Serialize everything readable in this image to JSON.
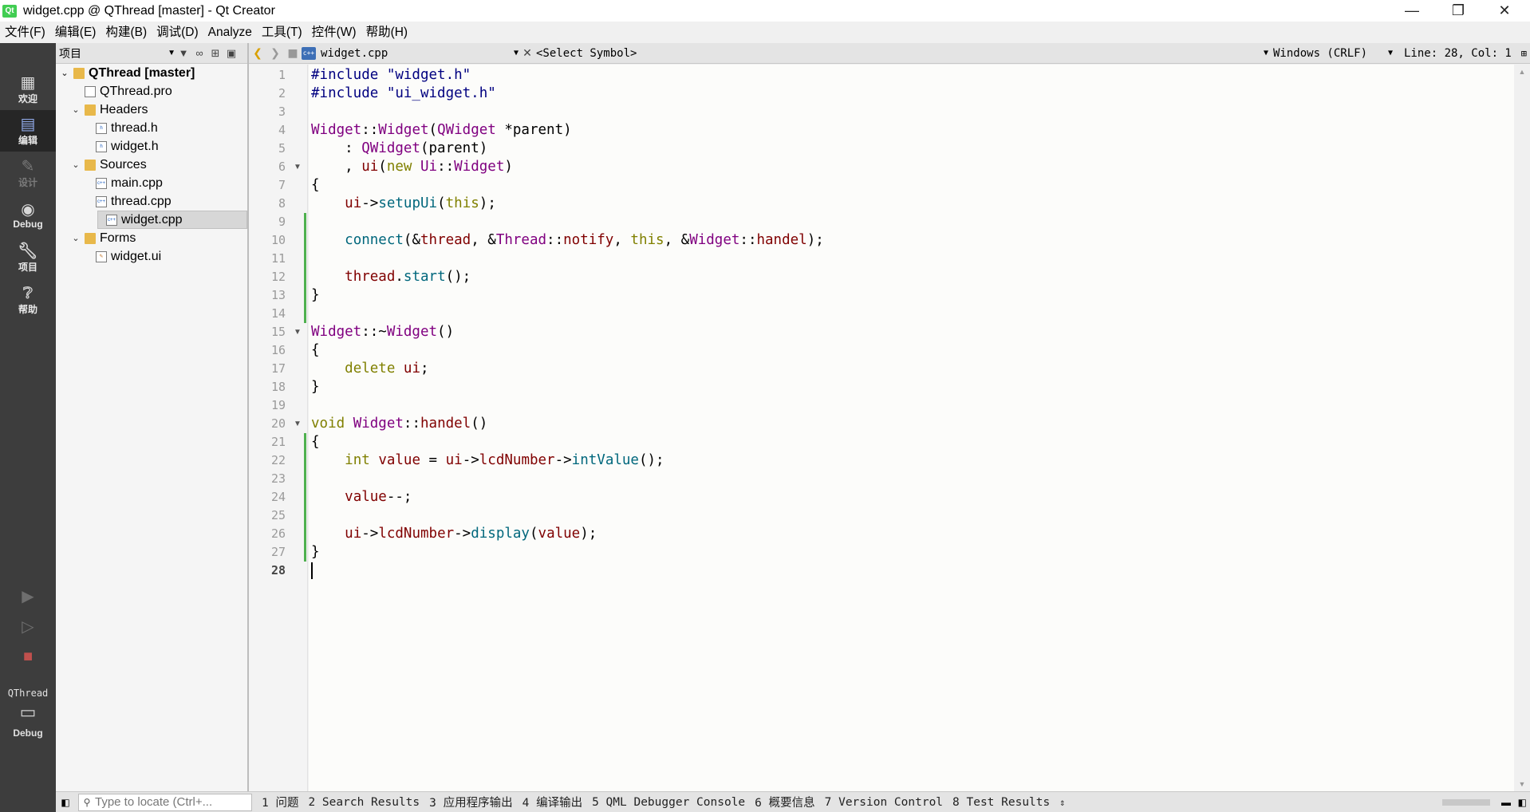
{
  "window": {
    "title": "widget.cpp @ QThread [master] - Qt Creator",
    "app_icon": "qt-icon",
    "controls": [
      "minimize-icon",
      "restore-icon",
      "close-icon"
    ]
  },
  "menubar": [
    "文件(F)",
    "编辑(E)",
    "构建(B)",
    "调试(D)",
    "Analyze",
    "工具(T)",
    "控件(W)",
    "帮助(H)"
  ],
  "modebar": {
    "modes": [
      {
        "label": "欢迎",
        "icon": "grid-icon"
      },
      {
        "label": "编辑",
        "icon": "edit-icon"
      },
      {
        "label": "设计",
        "icon": "pencil-icon"
      },
      {
        "label": "Debug",
        "icon": "bug-icon"
      },
      {
        "label": "项目",
        "icon": "wrench-icon"
      },
      {
        "label": "帮助",
        "icon": "help-icon"
      }
    ],
    "kit_project": "QThread",
    "kit_mode": "Debug",
    "run_icons": [
      "run-icon",
      "debug-run-icon",
      "build-icon"
    ]
  },
  "projects": {
    "selector": "项目",
    "tree": [
      {
        "label": "QThread [master]",
        "level": 0,
        "type": "project",
        "expanded": true
      },
      {
        "label": "QThread.pro",
        "level": 1,
        "type": "file"
      },
      {
        "label": "Headers",
        "level": 1,
        "type": "folder",
        "expanded": true
      },
      {
        "label": "thread.h",
        "level": 2,
        "type": "file"
      },
      {
        "label": "widget.h",
        "level": 2,
        "type": "file"
      },
      {
        "label": "Sources",
        "level": 1,
        "type": "folder",
        "expanded": true
      },
      {
        "label": "main.cpp",
        "level": 2,
        "type": "file"
      },
      {
        "label": "thread.cpp",
        "level": 2,
        "type": "file"
      },
      {
        "label": "widget.cpp",
        "level": 2,
        "type": "file",
        "selected": true
      },
      {
        "label": "Forms",
        "level": 1,
        "type": "folder",
        "expanded": true
      },
      {
        "label": "widget.ui",
        "level": 2,
        "type": "file"
      }
    ]
  },
  "editor": {
    "file_name": "widget.cpp",
    "symbol": "<Select Symbol>",
    "line_ending": "Windows (CRLF)",
    "position": "Line: 28, Col: 1",
    "current_line": 28,
    "line_numbers": [
      "1",
      "2",
      "3",
      "4",
      "5",
      "6",
      "7",
      "8",
      "9",
      "10",
      "11",
      "12",
      "13",
      "14",
      "15",
      "16",
      "17",
      "18",
      "19",
      "20",
      "21",
      "22",
      "23",
      "24",
      "25",
      "26",
      "27",
      "28"
    ],
    "lines": [
      "#include \"widget.h\"",
      "#include \"ui_widget.h\"",
      "",
      "Widget::Widget(QWidget *parent)",
      "    : QWidget(parent)",
      "    , ui(new Ui::Widget)",
      "{",
      "    ui->setupUi(this);",
      "",
      "    connect(&thread, &Thread::notify, this, &Widget::handel);",
      "",
      "    thread.start();",
      "}",
      "",
      "Widget::~Widget()",
      "{",
      "    delete ui;",
      "}",
      "",
      "void Widget::handel()",
      "{",
      "    int value = ui->lcdNumber->intValue();",
      "",
      "    value--;",
      "",
      "    ui->lcdNumber->display(value);",
      "}",
      ""
    ],
    "folded_lines": [
      6,
      15,
      20
    ],
    "modified_lines": [
      9,
      10,
      11,
      12,
      13,
      21,
      22,
      23,
      24,
      25,
      26,
      27
    ]
  },
  "statusbar": {
    "locator_placeholder": "Type to locate (Ctrl+...",
    "panes": [
      "1 问题",
      "2 Search Results",
      "3 应用程序输出",
      "4 编译输出",
      "5 QML Debugger Console",
      "6 概要信息",
      "7 Version Control",
      "8 Test Results"
    ]
  },
  "colors": {
    "keyword": "#808000",
    "preprocessor": "#000080",
    "string": "#008000",
    "type": "#800080",
    "function": "#00677c",
    "member": "#800000",
    "modified_marker": "#4fb14f",
    "modebar_bg": "#3d3d3d"
  }
}
